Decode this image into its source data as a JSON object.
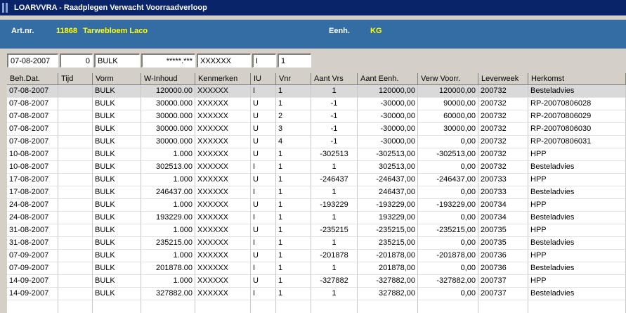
{
  "window": {
    "title": "LOARVVRA - Raadplegen Verwacht Voorraadverloop"
  },
  "header": {
    "artnr_label": "Art.nr.",
    "artnr_value": "11868",
    "article_name": "Tarwebloem Laco",
    "unit_label": "Eenh.",
    "unit_value": "KG"
  },
  "filters": {
    "date": "07-08-2007",
    "time": "0",
    "form": "BULK",
    "w_inhoud": "*****.***",
    "kenmerken": "XXXXXX",
    "iu": "I",
    "vnr": "1"
  },
  "columns": [
    "Beh.Dat.",
    "Tijd",
    "Vorm",
    "W-Inhoud",
    "Kenmerken",
    "IU",
    "Vnr",
    "Aant Vrs",
    "Aant Eenh.",
    "Verw Voorr.",
    "Leverweek",
    "Herkomst"
  ],
  "rows": [
    [
      "07-08-2007",
      "",
      "BULK",
      "120000.00",
      "XXXXXX",
      "I",
      "1",
      "1",
      "120000,00",
      "120000,00",
      "200732",
      "Besteladvies"
    ],
    [
      "07-08-2007",
      "",
      "BULK",
      "30000.000",
      "XXXXXX",
      "U",
      "1",
      "-1",
      "-30000,00",
      "90000,00",
      "200732",
      "RP-20070806028"
    ],
    [
      "07-08-2007",
      "",
      "BULK",
      "30000.000",
      "XXXXXX",
      "U",
      "2",
      "-1",
      "-30000,00",
      "60000,00",
      "200732",
      "RP-20070806029"
    ],
    [
      "07-08-2007",
      "",
      "BULK",
      "30000.000",
      "XXXXXX",
      "U",
      "3",
      "-1",
      "-30000,00",
      "30000,00",
      "200732",
      "RP-20070806030"
    ],
    [
      "07-08-2007",
      "",
      "BULK",
      "30000.000",
      "XXXXXX",
      "U",
      "4",
      "-1",
      "-30000,00",
      "0,00",
      "200732",
      "RP-20070806031"
    ],
    [
      "10-08-2007",
      "",
      "BULK",
      "1.000",
      "XXXXXX",
      "U",
      "1",
      "-302513",
      "-302513,00",
      "-302513,00",
      "200732",
      "HPP"
    ],
    [
      "10-08-2007",
      "",
      "BULK",
      "302513.00",
      "XXXXXX",
      "I",
      "1",
      "1",
      "302513,00",
      "0,00",
      "200732",
      "Besteladvies"
    ],
    [
      "17-08-2007",
      "",
      "BULK",
      "1.000",
      "XXXXXX",
      "U",
      "1",
      "-246437",
      "-246437,00",
      "-246437,00",
      "200733",
      "HPP"
    ],
    [
      "17-08-2007",
      "",
      "BULK",
      "246437.00",
      "XXXXXX",
      "I",
      "1",
      "1",
      "246437,00",
      "0,00",
      "200733",
      "Besteladvies"
    ],
    [
      "24-08-2007",
      "",
      "BULK",
      "1.000",
      "XXXXXX",
      "U",
      "1",
      "-193229",
      "-193229,00",
      "-193229,00",
      "200734",
      "HPP"
    ],
    [
      "24-08-2007",
      "",
      "BULK",
      "193229.00",
      "XXXXXX",
      "I",
      "1",
      "1",
      "193229,00",
      "0,00",
      "200734",
      "Besteladvies"
    ],
    [
      "31-08-2007",
      "",
      "BULK",
      "1.000",
      "XXXXXX",
      "U",
      "1",
      "-235215",
      "-235215,00",
      "-235215,00",
      "200735",
      "HPP"
    ],
    [
      "31-08-2007",
      "",
      "BULK",
      "235215.00",
      "XXXXXX",
      "I",
      "1",
      "1",
      "235215,00",
      "0,00",
      "200735",
      "Besteladvies"
    ],
    [
      "07-09-2007",
      "",
      "BULK",
      "1.000",
      "XXXXXX",
      "U",
      "1",
      "-201878",
      "-201878,00",
      "-201878,00",
      "200736",
      "HPP"
    ],
    [
      "07-09-2007",
      "",
      "BULK",
      "201878.00",
      "XXXXXX",
      "I",
      "1",
      "1",
      "201878,00",
      "0,00",
      "200736",
      "Besteladvies"
    ],
    [
      "14-09-2007",
      "",
      "BULK",
      "1.000",
      "XXXXXX",
      "U",
      "1",
      "-327882",
      "-327882,00",
      "-327882,00",
      "200737",
      "HPP"
    ],
    [
      "14-09-2007",
      "",
      "BULK",
      "327882.00",
      "XXXXXX",
      "I",
      "1",
      "1",
      "327882,00",
      "0,00",
      "200737",
      "Besteladvies"
    ]
  ]
}
